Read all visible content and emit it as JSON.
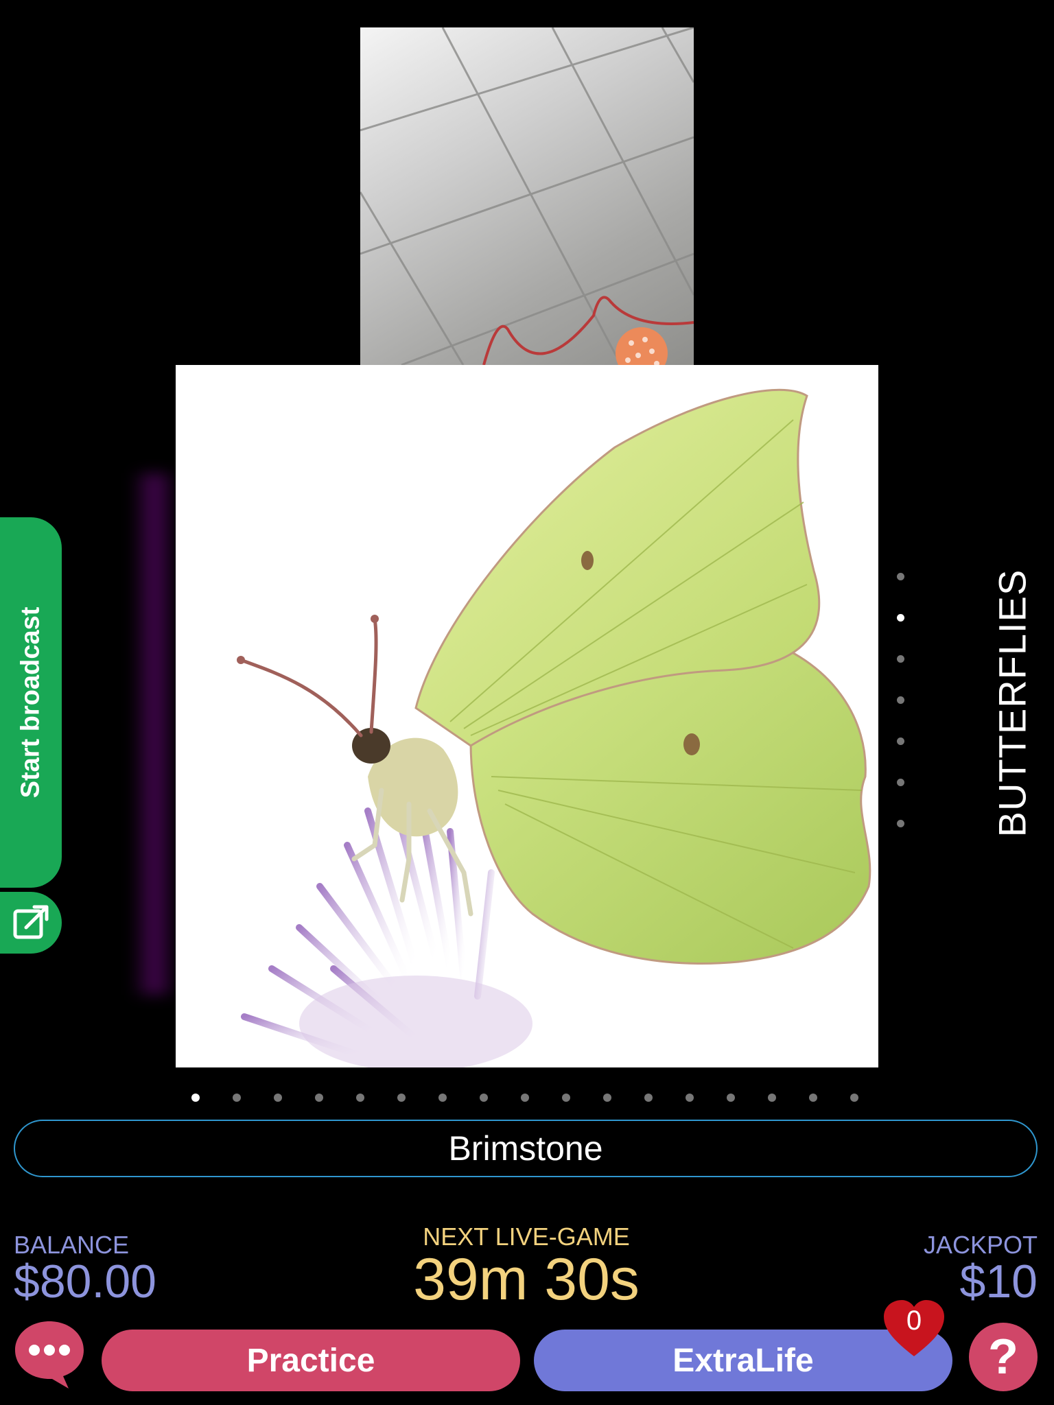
{
  "sidebar": {
    "broadcast_label": "Start broadcast",
    "share_icon": "share-icon"
  },
  "carousel": {
    "category": "BUTTERFLIES",
    "item_name": "Brimstone",
    "vertical_dots_count": 7,
    "vertical_active_index": 1,
    "horizontal_dots_count": 17,
    "horizontal_active_index": 0
  },
  "stats": {
    "balance_label": "BALANCE",
    "balance_value": "$80.00",
    "next_label": "NEXT LIVE-GAME",
    "next_value": "39m 30s",
    "jackpot_label": "JACKPOT",
    "jackpot_value": "$10"
  },
  "actions": {
    "practice_label": "Practice",
    "extralife_label": "ExtraLife",
    "extralife_count": "0",
    "help_label": "?",
    "chat_icon": "chat-bubble-icon"
  },
  "colors": {
    "green": "#19a855",
    "pink": "#d04668",
    "periwinkle": "#7078d8",
    "gold": "#f3d27e",
    "label_blue": "#8d94dd",
    "outline_blue": "#2f97cf",
    "heart_red": "#c8141e"
  }
}
